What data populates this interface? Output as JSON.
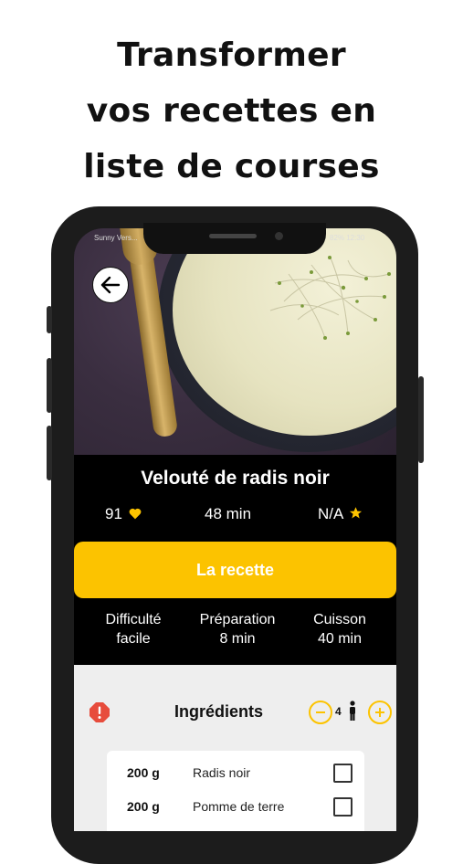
{
  "headline": [
    "Transformer",
    "vos recettes en",
    "liste de courses"
  ],
  "status_bar": {
    "left": "Sunny Vers...",
    "right": "82% 12:30"
  },
  "recipe": {
    "title": "Velouté de radis noir",
    "likes": "91",
    "time": "48 min",
    "rating": "N/A"
  },
  "cta_label": "La recette",
  "meta": [
    {
      "label": "Difficulté",
      "value": "facile"
    },
    {
      "label": "Préparation",
      "value": "8 min"
    },
    {
      "label": "Cuisson",
      "value": "40 min"
    }
  ],
  "ingredients": {
    "title": "Ingrédients",
    "servings": "4",
    "items": [
      {
        "qty": "200 g",
        "name": "Radis noir"
      },
      {
        "qty": "200 g",
        "name": "Pomme de terre"
      }
    ]
  },
  "colors": {
    "accent": "#fcc300",
    "alert": "#e74c3c",
    "background": "#000000"
  },
  "icons": [
    "arrow-left-icon",
    "heart-icon",
    "star-icon",
    "alert-icon",
    "minus-icon",
    "plus-icon",
    "person-icon",
    "checkbox-icon"
  ]
}
